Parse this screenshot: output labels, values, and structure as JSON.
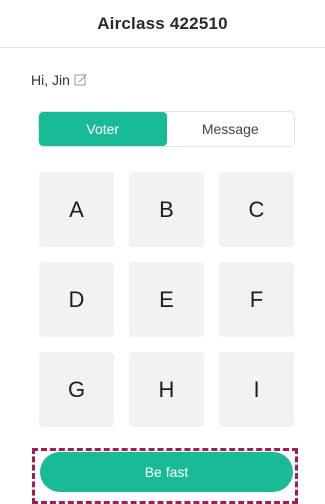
{
  "header": {
    "title": "Airclass 422510"
  },
  "greeting": {
    "text": "Hi, Jin",
    "edit_icon": "edit-icon"
  },
  "tabs": [
    {
      "label": "Voter",
      "active": true
    },
    {
      "label": "Message",
      "active": false
    }
  ],
  "options": [
    "A",
    "B",
    "C",
    "D",
    "E",
    "F",
    "G",
    "H",
    "I"
  ],
  "action": {
    "label": "Be fast"
  },
  "colors": {
    "accent": "#18bb95",
    "tile": "#f2f2f2",
    "highlight_frame": "#a31d55"
  }
}
